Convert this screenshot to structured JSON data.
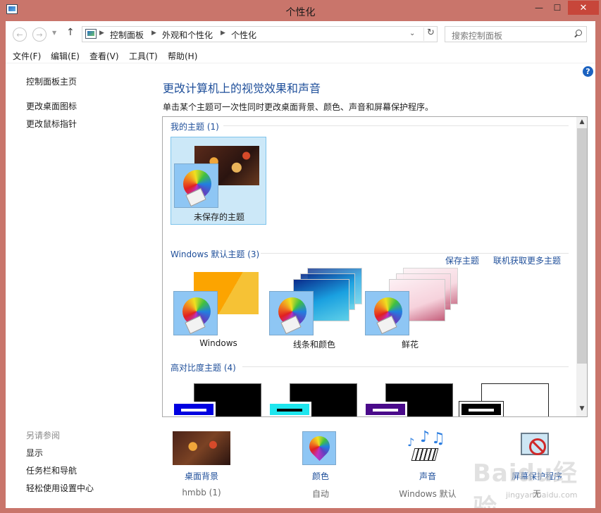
{
  "window": {
    "title": "个性化"
  },
  "address_bar": {
    "crumbs": [
      "控制面板",
      "外观和个性化",
      "个性化"
    ],
    "search_placeholder": "搜索控制面板"
  },
  "menu": [
    "文件(F)",
    "编辑(E)",
    "查看(V)",
    "工具(T)",
    "帮助(H)"
  ],
  "left_nav": {
    "links": [
      "控制面板主页",
      "更改桌面图标",
      "更改鼠标指针"
    ],
    "see_also_title": "另请参阅",
    "see_also_links": [
      "显示",
      "任务栏和导航",
      "轻松使用设置中心"
    ]
  },
  "main": {
    "title": "更改计算机上的视觉效果和声音",
    "description": "单击某个主题可一次性同时更改桌面背景、颜色、声音和屏幕保护程序。"
  },
  "groups": {
    "my_themes": {
      "header": "我的主题 (1)",
      "themes": [
        "未保存的主题"
      ],
      "actions": [
        "保存主题",
        "联机获取更多主题"
      ]
    },
    "windows_default": {
      "header": "Windows 默认主题 (3)",
      "themes": [
        "Windows",
        "线条和颜色",
        "鲜花"
      ]
    },
    "high_contrast": {
      "header": "高对比度主题 (4)"
    }
  },
  "bottom_bar": [
    {
      "label": "桌面背景",
      "value": "hmbb (1)"
    },
    {
      "label": "颜色",
      "value": "自动"
    },
    {
      "label": "声音",
      "value": "Windows 默认"
    },
    {
      "label": "屏幕保护程序",
      "value": "无"
    }
  ],
  "watermark": {
    "text": "Baidu经验",
    "url": "jingyan.baidu.com"
  },
  "colors": {
    "frame": "#c9756b",
    "close_button": "#c7463a",
    "link_blue": "#1f4f9a",
    "selected_tile": "#cce8f8"
  }
}
